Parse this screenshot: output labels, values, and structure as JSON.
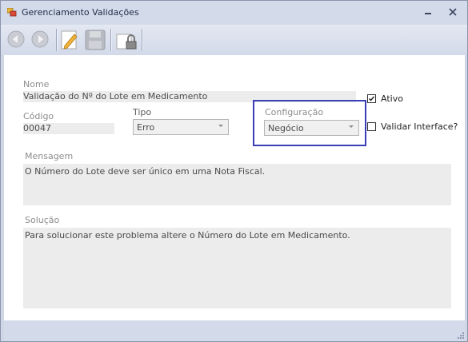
{
  "window": {
    "title": "Gerenciamento Validações",
    "minimize_icon": "minimize-icon",
    "close_icon": "close-icon"
  },
  "toolbar": {
    "buttons": [
      {
        "name": "back-button",
        "icon": "arrow-left-icon",
        "enabled": false
      },
      {
        "name": "forward-button",
        "icon": "arrow-right-icon",
        "enabled": false
      },
      {
        "name": "edit-button",
        "icon": "pencil-icon",
        "enabled": true
      },
      {
        "name": "save-button",
        "icon": "floppy-disk-icon",
        "enabled": false
      },
      {
        "name": "lock-button",
        "icon": "lock-icon",
        "enabled": true
      }
    ]
  },
  "form": {
    "nome": {
      "label": "Nome",
      "value": "Validação do Nº do Lote em Medicamento"
    },
    "codigo": {
      "label": "Código",
      "value": "00047"
    },
    "tipo": {
      "label": "Tipo",
      "value": "Erro"
    },
    "configuracao": {
      "label": "Configuração",
      "value": "Negócio"
    },
    "ativo": {
      "label": "Ativo",
      "checked": true
    },
    "validar_interface": {
      "label": "Validar Interface?",
      "checked": false
    },
    "mensagem": {
      "label": "Mensagem",
      "value": "O Número do Lote deve ser único em uma Nota Fiscal."
    },
    "solucao": {
      "label": "Solução",
      "value": "Para solucionar este problema altere o Número do Lote em Medicamento."
    }
  },
  "colors": {
    "highlight_border": "#3b3fb5",
    "field_bg": "#ececec",
    "label_text": "#8c8c8c"
  }
}
